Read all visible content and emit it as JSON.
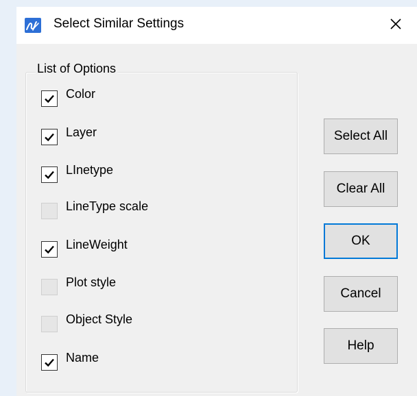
{
  "window": {
    "title": "Select Similar Settings",
    "app_icon": "app-logo-icon",
    "close_icon": "close-icon"
  },
  "options_group": {
    "legend": "List of Options",
    "items": [
      {
        "label": "Color",
        "checked": true
      },
      {
        "label": "Layer",
        "checked": true
      },
      {
        "label": "LInetype",
        "checked": true
      },
      {
        "label": "LineType scale",
        "checked": false
      },
      {
        "label": "LineWeight",
        "checked": true
      },
      {
        "label": "Plot style",
        "checked": false
      },
      {
        "label": "Object Style",
        "checked": false
      },
      {
        "label": "Name",
        "checked": true
      }
    ]
  },
  "buttons": {
    "select_all": "Select All",
    "clear_all": "Clear All",
    "ok": "OK",
    "cancel": "Cancel",
    "help": "Help"
  },
  "colors": {
    "dialog_bg": "#f0f0f0",
    "titlebar_bg": "#ffffff",
    "default_button_border": "#0078d7",
    "app_icon_bg": "#2d6fd6"
  }
}
